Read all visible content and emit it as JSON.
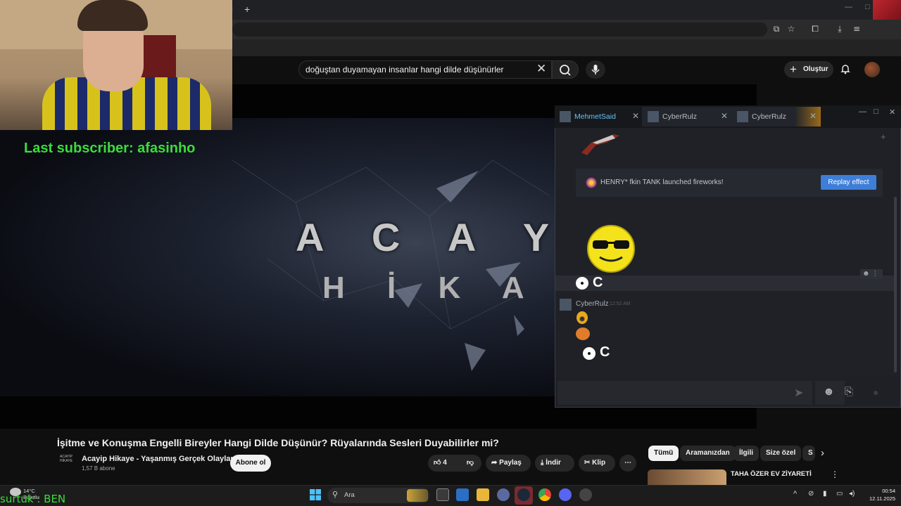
{
  "browser": {
    "new_tab": "+",
    "back_tab": "‹"
  },
  "youtube": {
    "search_value": "doğuştan duyamayan insanlar hangi dilde düşünürler",
    "create_label": "Oluştur",
    "video_title": "İşitme ve Konuşma Engelli Bireyler Hangi Dilde Düşünür? Rüyalarında Sesleri Duyabilirler mi?",
    "video_overlay_line1": "A C A Y İ",
    "video_overlay_line2": "H İ K A Y",
    "channel_name": "Acayip Hikaye - Yaşanmış Gerçek Olaylar",
    "channel_subs": "1,57 B abone",
    "channel_logo_text": "ACAYİP HİKAYE",
    "subscribe_label": "Abone ol",
    "like_count": "4",
    "share_label": "Paylaş",
    "download_label": "İndir",
    "clip_label": "Klip",
    "chips": [
      "Tümü",
      "Aramanızdan",
      "İlgili",
      "Size özel",
      "S"
    ],
    "rec_title": "TAHA ÖZER EV ZİYARETİ"
  },
  "stream": {
    "last_subscriber": "Last subscriber: afasinho",
    "bottom_overlay": "surtuk : BEN"
  },
  "steam_chat": {
    "tabs": [
      "MehmetSaid",
      "CyberRulz",
      "CyberRulz"
    ],
    "firework_text": "HENRY* fkin TANK launched fireworks!",
    "replay_label": "Replay effect",
    "sender": "CyberRulz",
    "sender_time": "12:52 AM"
  },
  "taskbar": {
    "search_label": "Ara",
    "weather_temp": "14°C",
    "weather_desc": "Bulutlu",
    "time": "00:54",
    "date": "12.11.2025"
  },
  "colors": {
    "accent_green": "#3cdc3c",
    "steam_blue": "#3d7ed8",
    "yt_bg": "#0f0f0f"
  }
}
